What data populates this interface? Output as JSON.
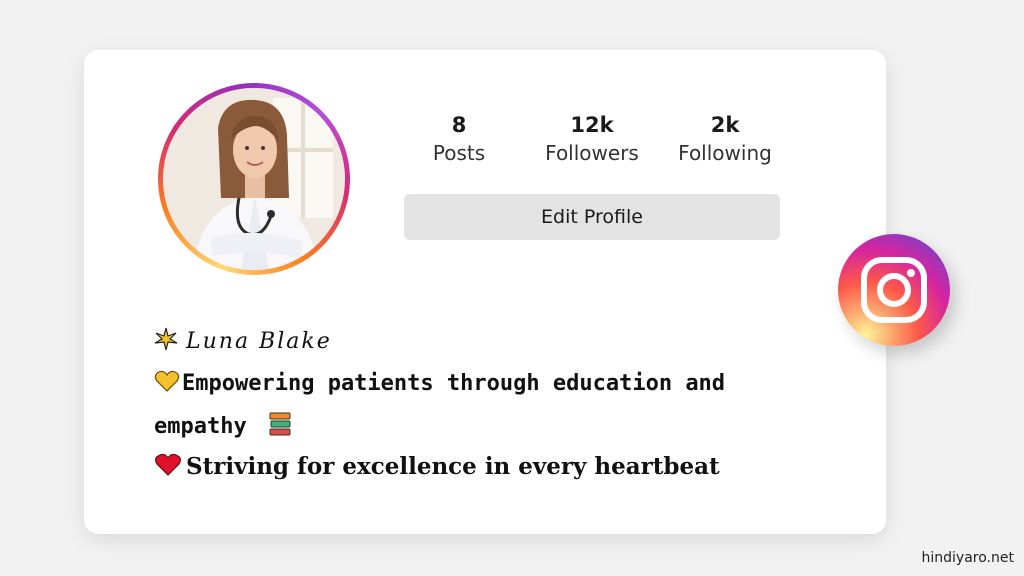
{
  "profile": {
    "stats": [
      {
        "value": "8",
        "label": "Posts"
      },
      {
        "value": "12k",
        "label": "Followers"
      },
      {
        "value": "2k",
        "label": "Following"
      }
    ],
    "edit_button_label": "Edit Profile"
  },
  "bio": {
    "name": "Luna Blake",
    "line1": "Empowering patients through education and",
    "line2": "empathy",
    "line3": "Striving for excellence in every heartbeat",
    "icons": [
      "sparkle-icon",
      "yellow-heart-icon",
      "books-icon",
      "red-heart-icon"
    ]
  },
  "brand": {
    "badge": "instagram-icon"
  },
  "watermark": "hindiyaro.net",
  "colors": {
    "card_bg": "#ffffff",
    "page_bg": "#f2f2f2",
    "button_bg": "#e3e3e3",
    "ring_gradient": [
      "#feda75",
      "#fa7e1e",
      "#d62976",
      "#962fbf"
    ]
  }
}
